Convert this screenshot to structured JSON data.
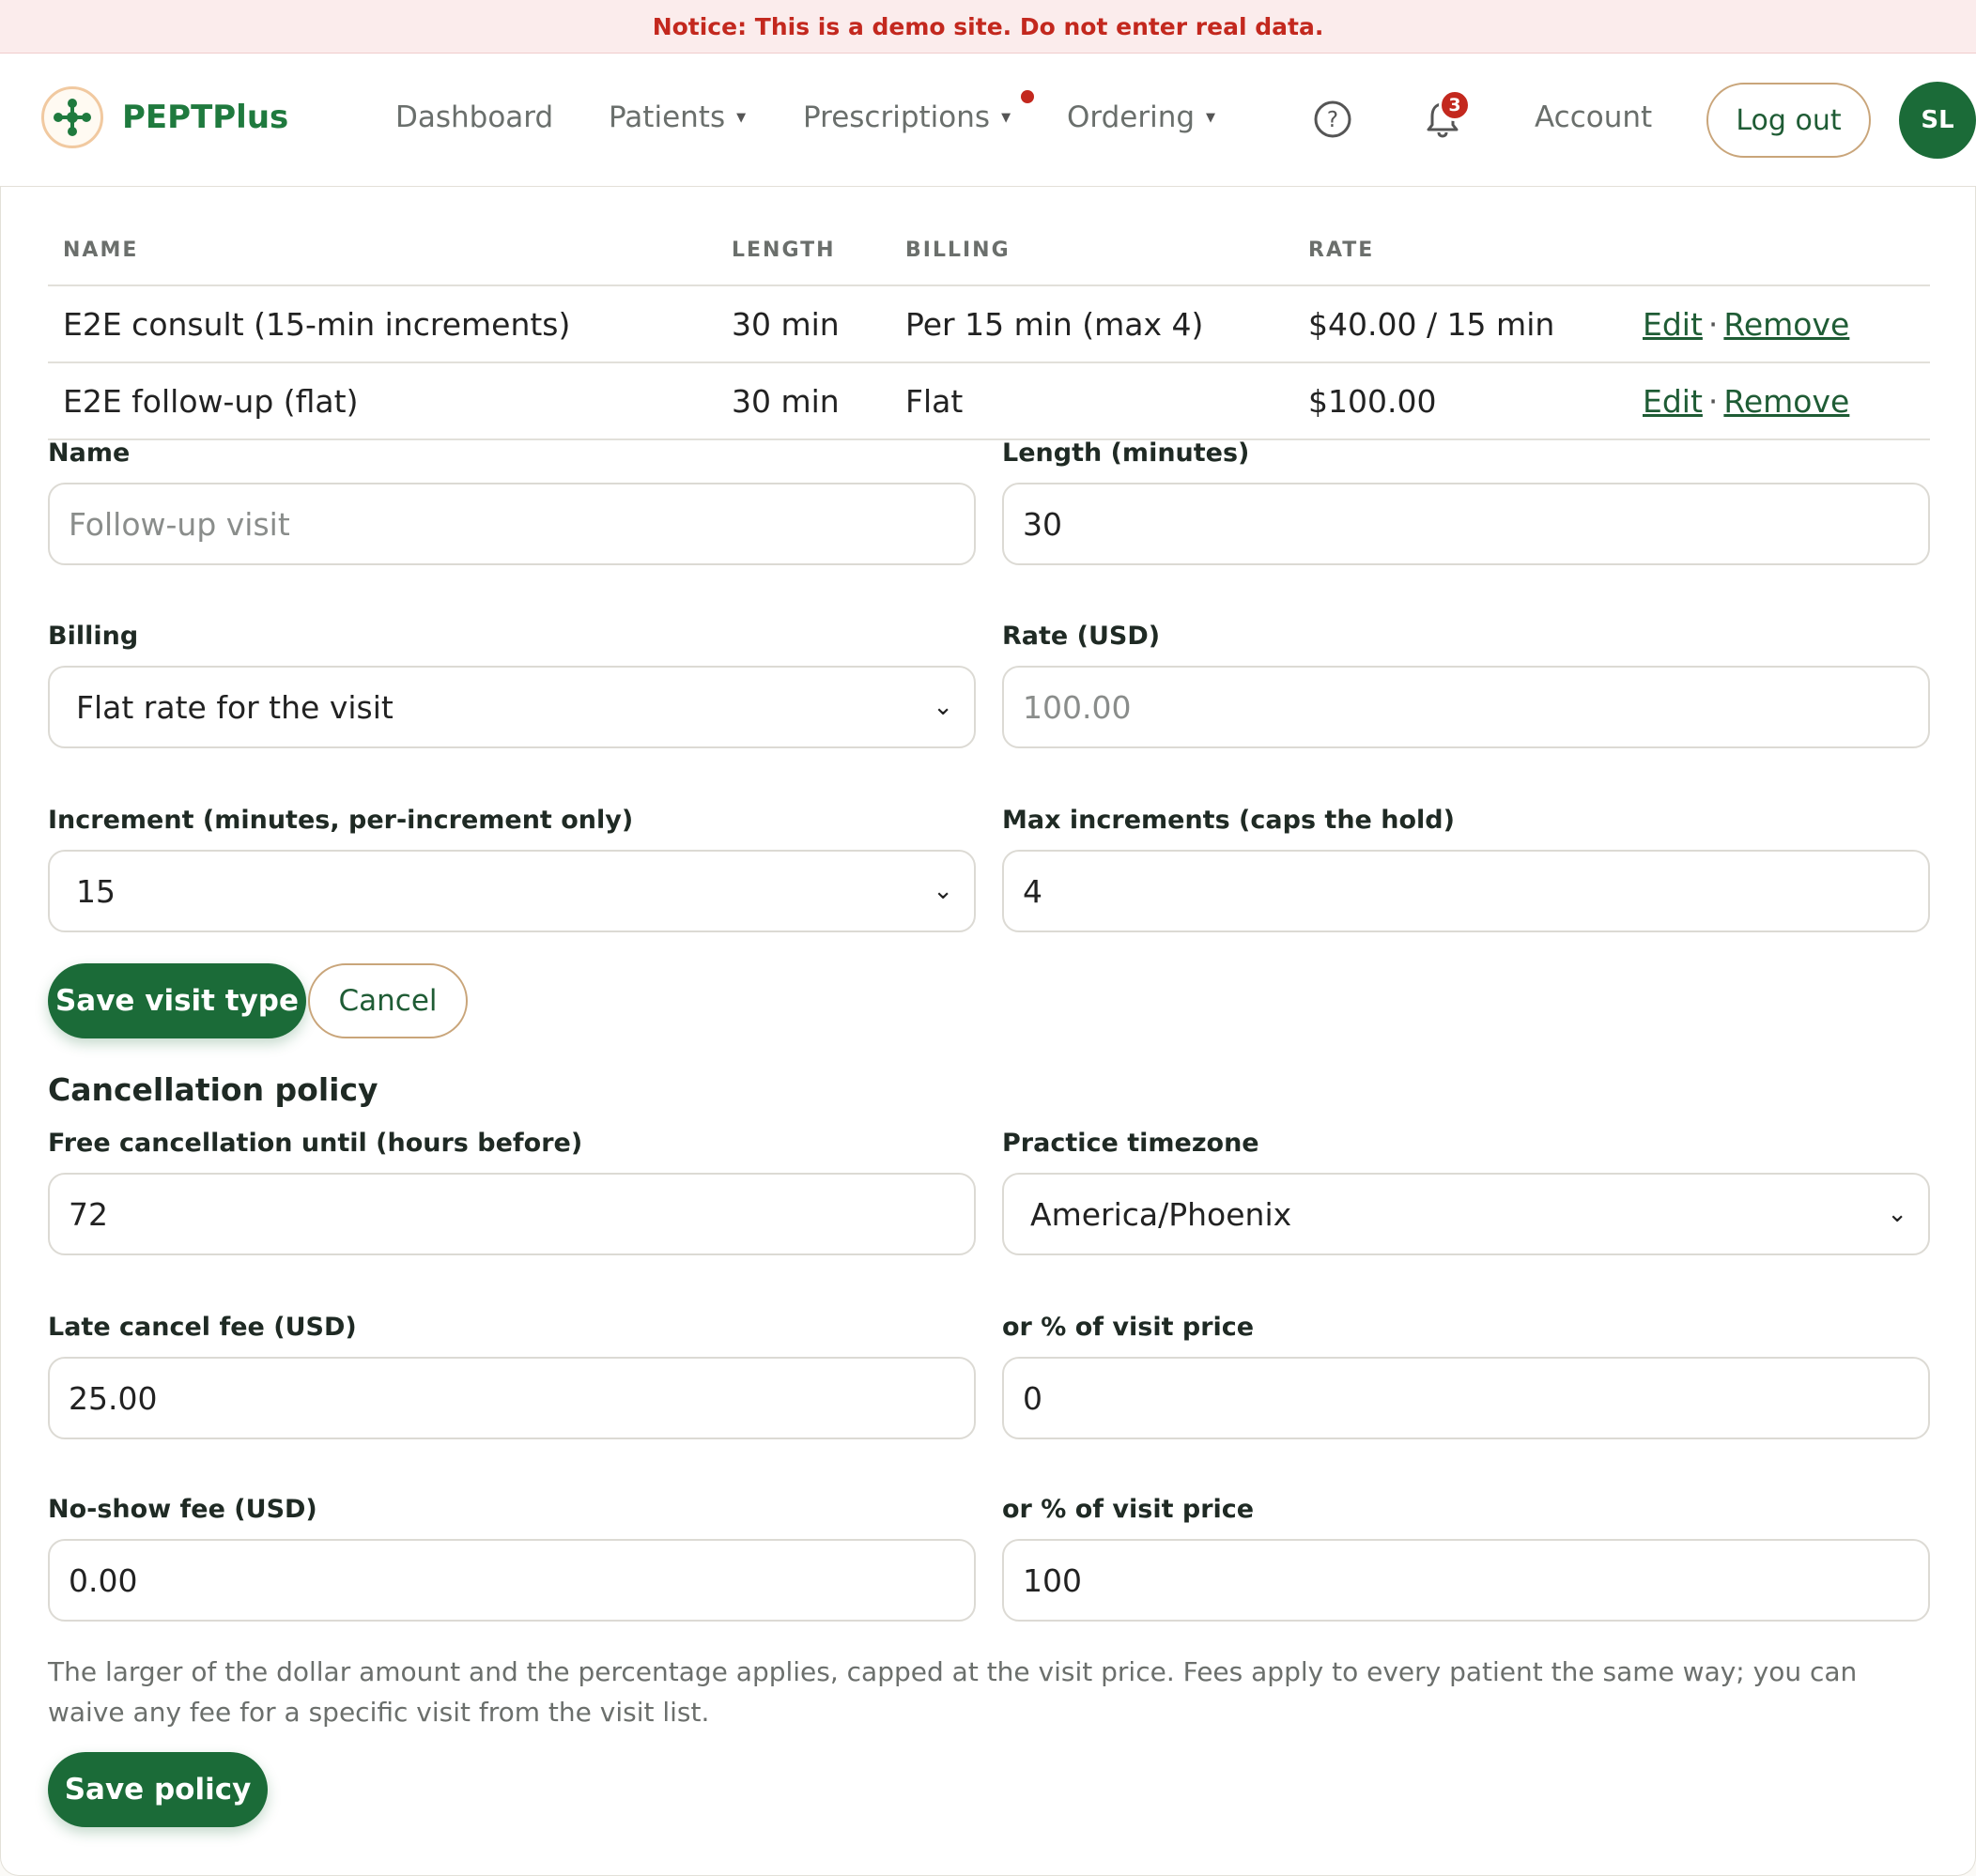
{
  "notice": "Notice: This is a demo site. Do not enter real data.",
  "brand": {
    "name": "PEPTPlus"
  },
  "nav": {
    "dashboard": "Dashboard",
    "patients": "Patients",
    "prescriptions": "Prescriptions",
    "ordering": "Ordering",
    "account": "Account",
    "logout": "Log out",
    "avatar_initials": "SL",
    "notification_count": "3"
  },
  "visit_types": {
    "columns": [
      "NAME",
      "LENGTH",
      "BILLING",
      "RATE"
    ],
    "rows": [
      {
        "name": "E2E consult (15-min increments)",
        "length": "30 min",
        "billing": "Per 15 min (max 4)",
        "rate": "$40.00 / 15 min",
        "edit": "Edit",
        "remove": "Remove"
      },
      {
        "name": "E2E follow-up (flat)",
        "length": "30 min",
        "billing": "Flat",
        "rate": "$100.00",
        "edit": "Edit",
        "remove": "Remove"
      }
    ]
  },
  "visit_form": {
    "name_label": "Name",
    "name_placeholder": "Follow-up visit",
    "length_label": "Length (minutes)",
    "length_value": "30",
    "billing_label": "Billing",
    "billing_value": "Flat rate for the visit",
    "rate_label": "Rate (USD)",
    "rate_placeholder": "100.00",
    "increment_label": "Increment (minutes, per-increment only)",
    "increment_value": "15",
    "max_increments_label": "Max increments (caps the hold)",
    "max_increments_value": "4",
    "save_label": "Save visit type",
    "cancel_label": "Cancel"
  },
  "policy": {
    "title": "Cancellation policy",
    "free_cancel_label": "Free cancellation until (hours before)",
    "free_cancel_value": "72",
    "timezone_label": "Practice timezone",
    "timezone_value": "America/Phoenix",
    "late_fee_label": "Late cancel fee (USD)",
    "late_fee_value": "25.00",
    "late_pct_label": "or % of visit price",
    "late_pct_value": "0",
    "noshow_fee_label": "No-show fee (USD)",
    "noshow_fee_value": "0.00",
    "noshow_pct_label": "or % of visit price",
    "noshow_pct_value": "100",
    "help": "The larger of the dollar amount and the percentage applies, capped at the visit price. Fees apply to every patient the same way; you can waive any fee for a specific visit from the visit list.",
    "save_label": "Save policy"
  },
  "colors": {
    "brand_green": "#1b6b38",
    "notice_red": "#c3281e",
    "accent_tan": "#c9a57a"
  },
  "icons": [
    "logo-icon",
    "help-circle-icon",
    "bell-icon",
    "chevron-down-icon",
    "caret-down-icon"
  ]
}
